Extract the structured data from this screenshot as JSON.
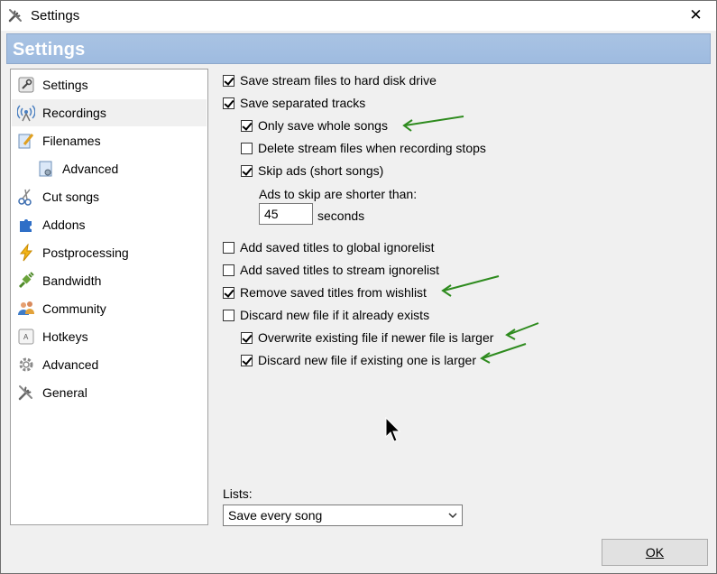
{
  "window": {
    "title": "Settings",
    "close_glyph": "✕",
    "banner_title": "Settings"
  },
  "sidebar": {
    "items": [
      {
        "label": "Settings",
        "icon": "wrench-settings-icon"
      },
      {
        "label": "Recordings",
        "icon": "antenna-icon",
        "selected": true
      },
      {
        "label": "Filenames",
        "icon": "pencil-note-icon"
      },
      {
        "label": "Advanced",
        "icon": "advanced-doc-icon",
        "indent": true
      },
      {
        "label": "Cut songs",
        "icon": "scissors-icon"
      },
      {
        "label": "Addons",
        "icon": "puzzle-icon"
      },
      {
        "label": "Postprocessing",
        "icon": "lightning-icon"
      },
      {
        "label": "Bandwidth",
        "icon": "plug-icon"
      },
      {
        "label": "Community",
        "icon": "people-icon"
      },
      {
        "label": "Hotkeys",
        "icon": "key-icon"
      },
      {
        "label": "Advanced",
        "icon": "gear-icon"
      },
      {
        "label": "General",
        "icon": "tools-icon"
      }
    ]
  },
  "options": {
    "save_stream_files": {
      "label": "Save stream files to hard disk drive",
      "checked": true
    },
    "save_separated": {
      "label": "Save separated tracks",
      "checked": true
    },
    "only_whole_songs": {
      "label": "Only save whole songs",
      "checked": true
    },
    "delete_stream_files": {
      "label": "Delete stream files when recording stops",
      "checked": false
    },
    "skip_ads": {
      "label": "Skip ads (short songs)",
      "checked": true
    },
    "ads_label": "Ads to skip are shorter than:",
    "ads_value": "45",
    "ads_unit": "seconds",
    "add_global_ignore": {
      "label": "Add saved titles to global ignorelist",
      "checked": false
    },
    "add_stream_ignore": {
      "label": "Add saved titles to stream ignorelist",
      "checked": false
    },
    "remove_wishlist": {
      "label": "Remove saved titles from wishlist",
      "checked": true
    },
    "discard_exists": {
      "label": "Discard new file if it already exists",
      "checked": false
    },
    "overwrite_newer": {
      "label": "Overwrite existing file if newer file is larger",
      "checked": true
    },
    "discard_larger": {
      "label": "Discard new file if existing one is larger",
      "checked": true
    }
  },
  "lists": {
    "label": "Lists:",
    "selected": "Save every song"
  },
  "footer": {
    "ok_label": "OK"
  },
  "colors": {
    "banner": "#a3bfe2",
    "annotation_arrow": "#2e8b1e"
  }
}
